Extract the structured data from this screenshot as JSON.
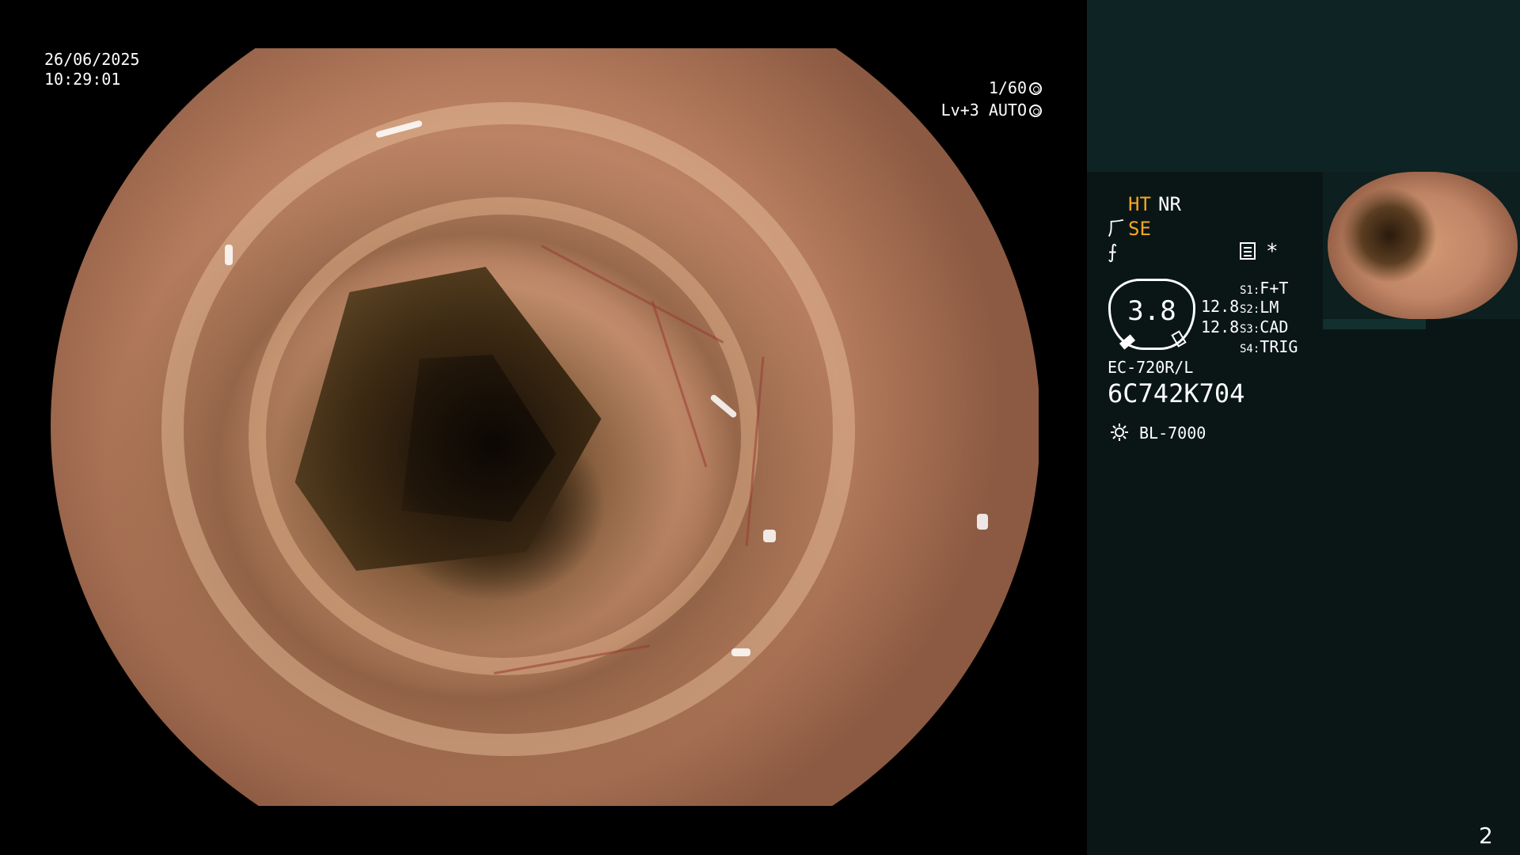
{
  "osd": {
    "date": "26/06/2025",
    "time": "10:29:01",
    "shutter": "1/60",
    "level": "Lv+3 AUTO"
  },
  "panel": {
    "ht": "HT",
    "nr": "NR",
    "se": "SE",
    "star": "*",
    "gauge_value": "3.8",
    "value1": "12.8",
    "value2": "12.8",
    "s1_label": "S1:",
    "s1_value": "F+T",
    "s2_label": "S2:",
    "s2_value": "LM",
    "s3_label": "S3:",
    "s3_value": "CAD",
    "s4_label": "S4:",
    "s4_value": "TRIG",
    "model": "EC-720R/L",
    "serial": "6C742K704",
    "light_source": "BL-7000"
  },
  "page_number": "2",
  "colors": {
    "accent_yellow": "#f6a623",
    "panel_bg": "#0a1616",
    "panel_top_bg": "#0e2323"
  }
}
